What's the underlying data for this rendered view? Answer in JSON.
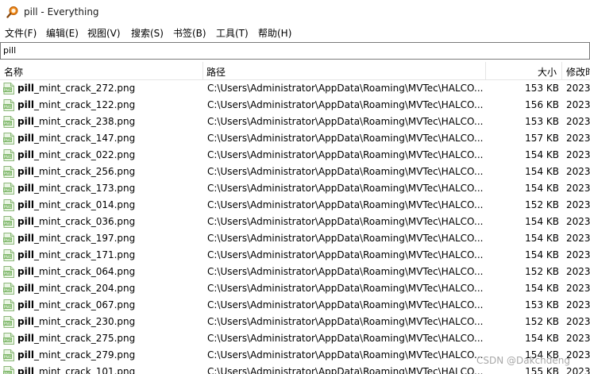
{
  "window": {
    "title": "pill - Everything"
  },
  "menu": [
    {
      "label": "文件(F)"
    },
    {
      "label": "编辑(E)"
    },
    {
      "label": "视图(V)"
    },
    {
      "label": "搜索(S)"
    },
    {
      "label": "书签(B)"
    },
    {
      "label": "工具(T)"
    },
    {
      "label": "帮助(H)"
    }
  ],
  "search": {
    "value": "pill"
  },
  "columns": {
    "name": "名称",
    "path": "路径",
    "size": "大小",
    "modified": "修改时"
  },
  "file_icon": "png-file-icon",
  "rows": [
    {
      "match": "pill",
      "rest": "_mint_crack_272.png",
      "path": "C:\\Users\\Administrator\\AppData\\Roaming\\MVTec\\HALCO...",
      "size": "153 KB",
      "date": "2023,"
    },
    {
      "match": "pill",
      "rest": "_mint_crack_122.png",
      "path": "C:\\Users\\Administrator\\AppData\\Roaming\\MVTec\\HALCO...",
      "size": "156 KB",
      "date": "2023,"
    },
    {
      "match": "pill",
      "rest": "_mint_crack_238.png",
      "path": "C:\\Users\\Administrator\\AppData\\Roaming\\MVTec\\HALCO...",
      "size": "153 KB",
      "date": "2023,"
    },
    {
      "match": "pill",
      "rest": "_mint_crack_147.png",
      "path": "C:\\Users\\Administrator\\AppData\\Roaming\\MVTec\\HALCO...",
      "size": "157 KB",
      "date": "2023,"
    },
    {
      "match": "pill",
      "rest": "_mint_crack_022.png",
      "path": "C:\\Users\\Administrator\\AppData\\Roaming\\MVTec\\HALCO...",
      "size": "154 KB",
      "date": "2023,"
    },
    {
      "match": "pill",
      "rest": "_mint_crack_256.png",
      "path": "C:\\Users\\Administrator\\AppData\\Roaming\\MVTec\\HALCO...",
      "size": "154 KB",
      "date": "2023,"
    },
    {
      "match": "pill",
      "rest": "_mint_crack_173.png",
      "path": "C:\\Users\\Administrator\\AppData\\Roaming\\MVTec\\HALCO...",
      "size": "154 KB",
      "date": "2023,"
    },
    {
      "match": "pill",
      "rest": "_mint_crack_014.png",
      "path": "C:\\Users\\Administrator\\AppData\\Roaming\\MVTec\\HALCO...",
      "size": "152 KB",
      "date": "2023,"
    },
    {
      "match": "pill",
      "rest": "_mint_crack_036.png",
      "path": "C:\\Users\\Administrator\\AppData\\Roaming\\MVTec\\HALCO...",
      "size": "154 KB",
      "date": "2023,"
    },
    {
      "match": "pill",
      "rest": "_mint_crack_197.png",
      "path": "C:\\Users\\Administrator\\AppData\\Roaming\\MVTec\\HALCO...",
      "size": "154 KB",
      "date": "2023,"
    },
    {
      "match": "pill",
      "rest": "_mint_crack_171.png",
      "path": "C:\\Users\\Administrator\\AppData\\Roaming\\MVTec\\HALCO...",
      "size": "154 KB",
      "date": "2023,"
    },
    {
      "match": "pill",
      "rest": "_mint_crack_064.png",
      "path": "C:\\Users\\Administrator\\AppData\\Roaming\\MVTec\\HALCO...",
      "size": "152 KB",
      "date": "2023,"
    },
    {
      "match": "pill",
      "rest": "_mint_crack_204.png",
      "path": "C:\\Users\\Administrator\\AppData\\Roaming\\MVTec\\HALCO...",
      "size": "154 KB",
      "date": "2023,"
    },
    {
      "match": "pill",
      "rest": "_mint_crack_067.png",
      "path": "C:\\Users\\Administrator\\AppData\\Roaming\\MVTec\\HALCO...",
      "size": "153 KB",
      "date": "2023,"
    },
    {
      "match": "pill",
      "rest": "_mint_crack_230.png",
      "path": "C:\\Users\\Administrator\\AppData\\Roaming\\MVTec\\HALCO...",
      "size": "152 KB",
      "date": "2023,"
    },
    {
      "match": "pill",
      "rest": "_mint_crack_275.png",
      "path": "C:\\Users\\Administrator\\AppData\\Roaming\\MVTec\\HALCO...",
      "size": "154 KB",
      "date": "2023,"
    },
    {
      "match": "pill",
      "rest": "_mint_crack_279.png",
      "path": "C:\\Users\\Administrator\\AppData\\Roaming\\MVTec\\HALCO...",
      "size": "154 KB",
      "date": "2023,"
    },
    {
      "match": "pill",
      "rest": "_mint_crack_101.png",
      "path": "C:\\Users\\Administrator\\AppData\\Roaming\\MVTec\\HALCO...",
      "size": "155 KB",
      "date": "2023,"
    }
  ],
  "watermark": "CSDN @Dakchdeng"
}
